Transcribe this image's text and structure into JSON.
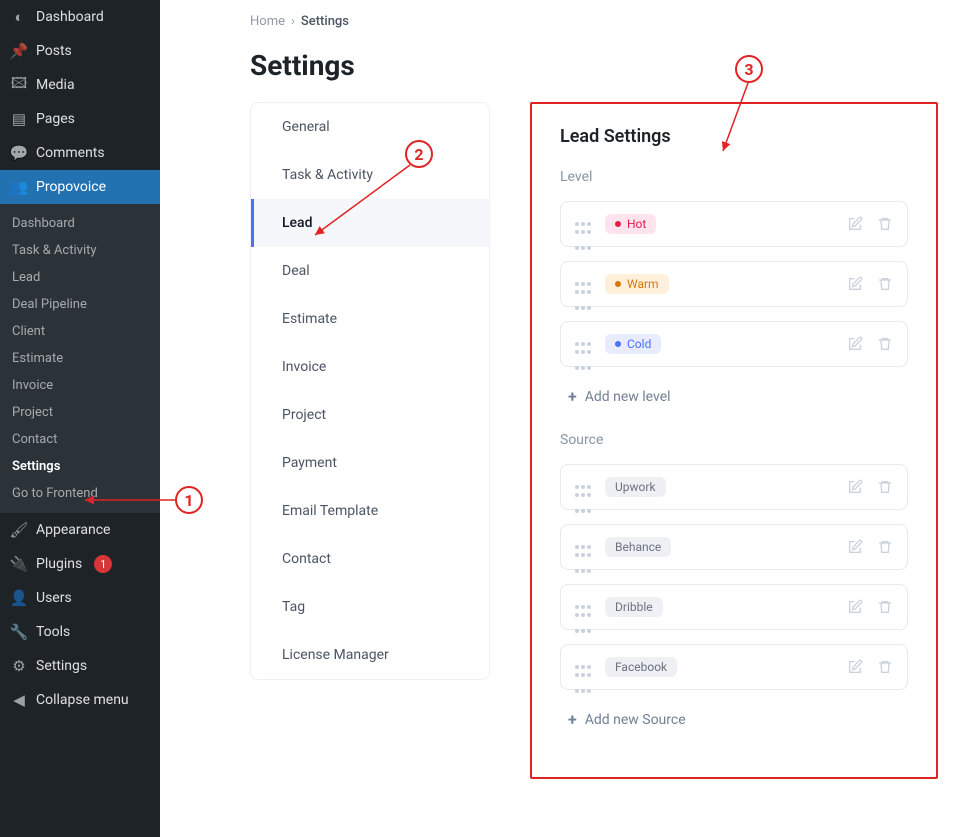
{
  "wp_sidebar": {
    "items_top": [
      {
        "label": "Dashboard",
        "icon": "dashboard"
      },
      {
        "label": "Posts",
        "icon": "pin"
      },
      {
        "label": "Media",
        "icon": "media"
      },
      {
        "label": "Pages",
        "icon": "page"
      },
      {
        "label": "Comments",
        "icon": "comment"
      }
    ],
    "propovoice_label": "Propovoice",
    "propovoice_sub": [
      {
        "label": "Dashboard"
      },
      {
        "label": "Task & Activity"
      },
      {
        "label": "Lead"
      },
      {
        "label": "Deal Pipeline"
      },
      {
        "label": "Client"
      },
      {
        "label": "Estimate"
      },
      {
        "label": "Invoice"
      },
      {
        "label": "Project"
      },
      {
        "label": "Contact"
      },
      {
        "label": "Settings",
        "highlight": true
      },
      {
        "label": "Go to Frontend"
      }
    ],
    "items_bottom": [
      {
        "label": "Appearance",
        "icon": "appearance"
      },
      {
        "label": "Plugins",
        "icon": "plugin",
        "badge": "1"
      },
      {
        "label": "Users",
        "icon": "user"
      },
      {
        "label": "Tools",
        "icon": "tool"
      },
      {
        "label": "Settings",
        "icon": "settings"
      },
      {
        "label": "Collapse menu",
        "icon": "collapse"
      }
    ]
  },
  "breadcrumb": {
    "home": "Home",
    "current": "Settings"
  },
  "page_title": "Settings",
  "settings_tabs": [
    "General",
    "Task & Activity",
    "Lead",
    "Deal",
    "Estimate",
    "Invoice",
    "Project",
    "Payment",
    "Email Template",
    "Contact",
    "Tag",
    "License Manager"
  ],
  "panel": {
    "title": "Lead Settings",
    "level_label": "Level",
    "levels": [
      {
        "label": "Hot",
        "style": "hot"
      },
      {
        "label": "Warm",
        "style": "warm"
      },
      {
        "label": "Cold",
        "style": "cold"
      }
    ],
    "add_level": "Add new level",
    "source_label": "Source",
    "sources": [
      {
        "label": "Upwork"
      },
      {
        "label": "Behance"
      },
      {
        "label": "Dribble"
      },
      {
        "label": "Facebook"
      }
    ],
    "add_source": "Add new Source"
  },
  "annotations": {
    "a1": "1",
    "a2": "2",
    "a3": "3"
  }
}
